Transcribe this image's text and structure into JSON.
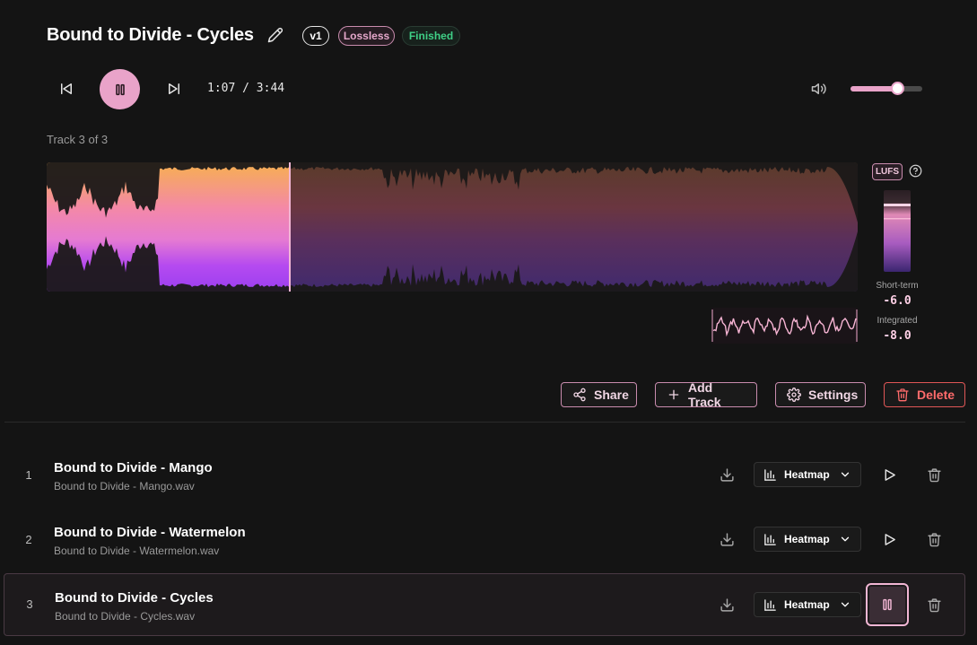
{
  "header": {
    "title": "Bound to Divide - Cycles",
    "version_badge": "v1",
    "format_badge": "Lossless",
    "status_badge": "Finished"
  },
  "player": {
    "time": "1:07 / 3:44",
    "volume_level": 0.66,
    "progress": 0.3,
    "track_position": "Track 3 of 3"
  },
  "loudness": {
    "tag": "LUFS",
    "short_term_label": "Short-term",
    "short_term_value": "-6.0",
    "integrated_label": "Integrated",
    "integrated_value": "-8.0"
  },
  "actions": {
    "share": "Share",
    "add_track": "Add Track",
    "settings": "Settings",
    "delete": "Delete"
  },
  "tracks": [
    {
      "number": "1",
      "title": "Bound to Divide - Mango",
      "file": "Bound to Divide - Mango.wav",
      "view": "Heatmap",
      "state": "play"
    },
    {
      "number": "2",
      "title": "Bound to Divide - Watermelon",
      "file": "Bound to Divide - Watermelon.wav",
      "view": "Heatmap",
      "state": "play"
    },
    {
      "number": "3",
      "title": "Bound to Divide - Cycles",
      "file": "Bound to Divide - Cycles.wav",
      "view": "Heatmap",
      "state": "pause"
    }
  ],
  "colors": {
    "accent": "#e9a3c9",
    "status_green": "#3fcf86",
    "danger": "#e05656"
  },
  "icons": {
    "edit": "pencil-icon",
    "prev": "skip-back-icon",
    "pause": "pause-icon",
    "next": "skip-forward-icon",
    "volume": "volume-icon",
    "help": "help-circle-icon",
    "share": "share-icon",
    "add": "plus-icon",
    "settings": "gear-icon",
    "delete": "trash-icon",
    "download": "download-icon",
    "heatmap": "bar-chart-icon",
    "play": "play-icon"
  }
}
